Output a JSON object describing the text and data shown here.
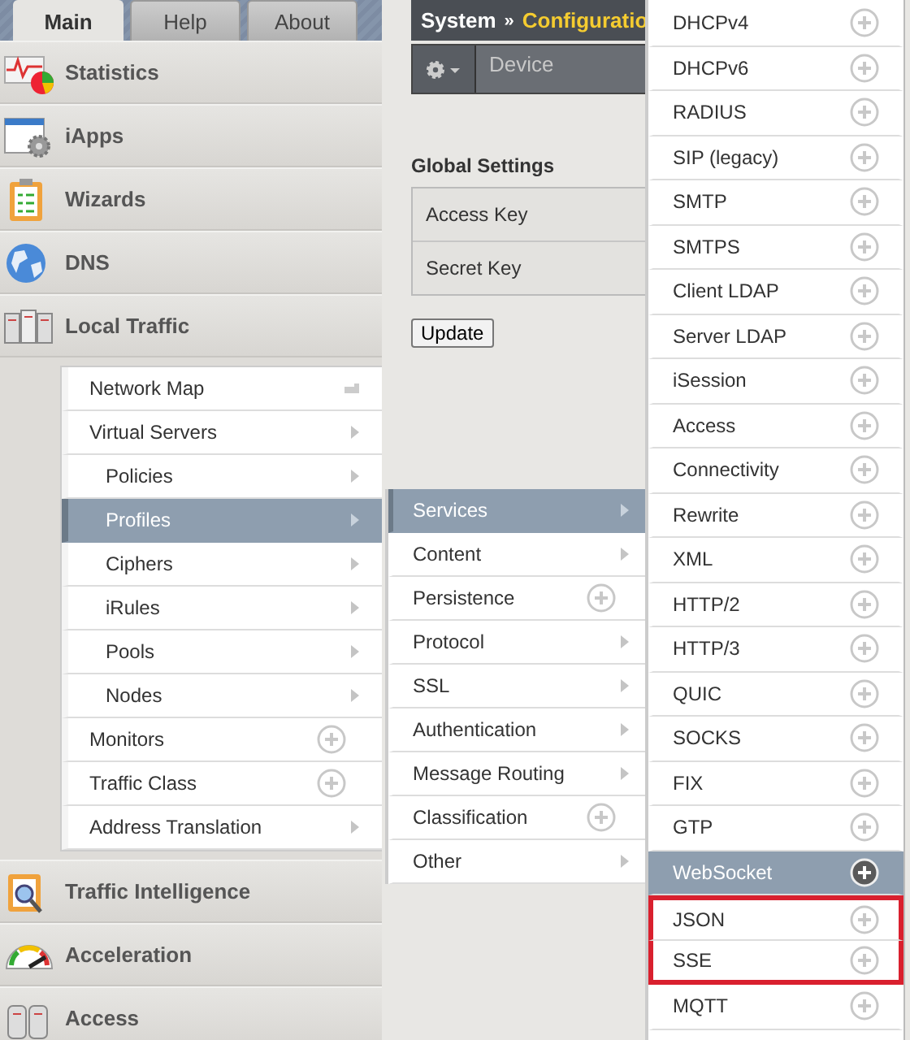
{
  "tabs": [
    {
      "label": "Main",
      "selected": true
    },
    {
      "label": "Help",
      "selected": false
    },
    {
      "label": "About",
      "selected": false
    }
  ],
  "sidebar": {
    "items": [
      {
        "label": "Statistics"
      },
      {
        "label": "iApps"
      },
      {
        "label": "Wizards"
      },
      {
        "label": "DNS"
      },
      {
        "label": "Local Traffic",
        "children": [
          {
            "label": "Network Map",
            "kind": "map",
            "selected": false
          },
          {
            "label": "Virtual Servers",
            "kind": "submenu",
            "selected": false,
            "children": [
              {
                "label": "Policies",
                "kind": "submenu",
                "selected": false
              },
              {
                "label": "Profiles",
                "kind": "submenu",
                "selected": true,
                "children": [
                  {
                    "label": "Services",
                    "kind": "submenu",
                    "selected": true,
                    "children": [
                      {
                        "label": "DHCPv4",
                        "selected": false,
                        "highlighted": false
                      },
                      {
                        "label": "DHCPv6",
                        "selected": false,
                        "highlighted": false
                      },
                      {
                        "label": "RADIUS",
                        "selected": false,
                        "highlighted": false
                      },
                      {
                        "label": "SIP (legacy)",
                        "selected": false,
                        "highlighted": false
                      },
                      {
                        "label": "SMTP",
                        "selected": false,
                        "highlighted": false
                      },
                      {
                        "label": "SMTPS",
                        "selected": false,
                        "highlighted": false
                      },
                      {
                        "label": "Client LDAP",
                        "selected": false,
                        "highlighted": false
                      },
                      {
                        "label": "Server LDAP",
                        "selected": false,
                        "highlighted": false
                      },
                      {
                        "label": "iSession",
                        "selected": false,
                        "highlighted": false
                      },
                      {
                        "label": "Access",
                        "selected": false,
                        "highlighted": false
                      },
                      {
                        "label": "Connectivity",
                        "selected": false,
                        "highlighted": false
                      },
                      {
                        "label": "Rewrite",
                        "selected": false,
                        "highlighted": false
                      },
                      {
                        "label": "XML",
                        "selected": false,
                        "highlighted": false
                      },
                      {
                        "label": "HTTP/2",
                        "selected": false,
                        "highlighted": false
                      },
                      {
                        "label": "HTTP/3",
                        "selected": false,
                        "highlighted": false
                      },
                      {
                        "label": "QUIC",
                        "selected": false,
                        "highlighted": false
                      },
                      {
                        "label": "SOCKS",
                        "selected": false,
                        "highlighted": false
                      },
                      {
                        "label": "FIX",
                        "selected": false,
                        "highlighted": false
                      },
                      {
                        "label": "GTP",
                        "selected": false,
                        "highlighted": false
                      },
                      {
                        "label": "WebSocket",
                        "selected": true,
                        "highlighted": false
                      },
                      {
                        "label": "JSON",
                        "selected": false,
                        "highlighted": true
                      },
                      {
                        "label": "SSE",
                        "selected": false,
                        "highlighted": true
                      },
                      {
                        "label": "MQTT",
                        "selected": false,
                        "highlighted": false
                      }
                    ]
                  },
                  {
                    "label": "Content",
                    "kind": "submenu",
                    "selected": false
                  },
                  {
                    "label": "Persistence",
                    "kind": "add",
                    "selected": false
                  },
                  {
                    "label": "Protocol",
                    "kind": "submenu",
                    "selected": false
                  },
                  {
                    "label": "SSL",
                    "kind": "submenu",
                    "selected": false
                  },
                  {
                    "label": "Authentication",
                    "kind": "submenu",
                    "selected": false
                  },
                  {
                    "label": "Message Routing",
                    "kind": "submenu",
                    "selected": false
                  },
                  {
                    "label": "Classification",
                    "kind": "add",
                    "selected": false
                  },
                  {
                    "label": "Other",
                    "kind": "submenu",
                    "selected": false
                  }
                ]
              },
              {
                "label": "Ciphers",
                "kind": "submenu",
                "selected": false
              },
              {
                "label": "iRules",
                "kind": "submenu",
                "selected": false
              },
              {
                "label": "Pools",
                "kind": "submenu",
                "selected": false
              },
              {
                "label": "Nodes",
                "kind": "submenu",
                "selected": false
              }
            ]
          },
          {
            "label": "Monitors",
            "kind": "add",
            "selected": false
          },
          {
            "label": "Traffic Class",
            "kind": "add",
            "selected": false
          },
          {
            "label": "Address Translation",
            "kind": "submenu",
            "selected": false
          }
        ]
      },
      {
        "label": "Traffic Intelligence"
      },
      {
        "label": "Acceleration"
      },
      {
        "label": "Access"
      }
    ]
  },
  "content": {
    "breadcrumb": {
      "section": "System",
      "separator": "»",
      "page": "Configuratio"
    },
    "toolbar": {
      "tab": "Device"
    },
    "section_title": "Global Settings",
    "settings": [
      {
        "label": "Access Key"
      },
      {
        "label": "Secret Key"
      }
    ],
    "button": "Update"
  }
}
